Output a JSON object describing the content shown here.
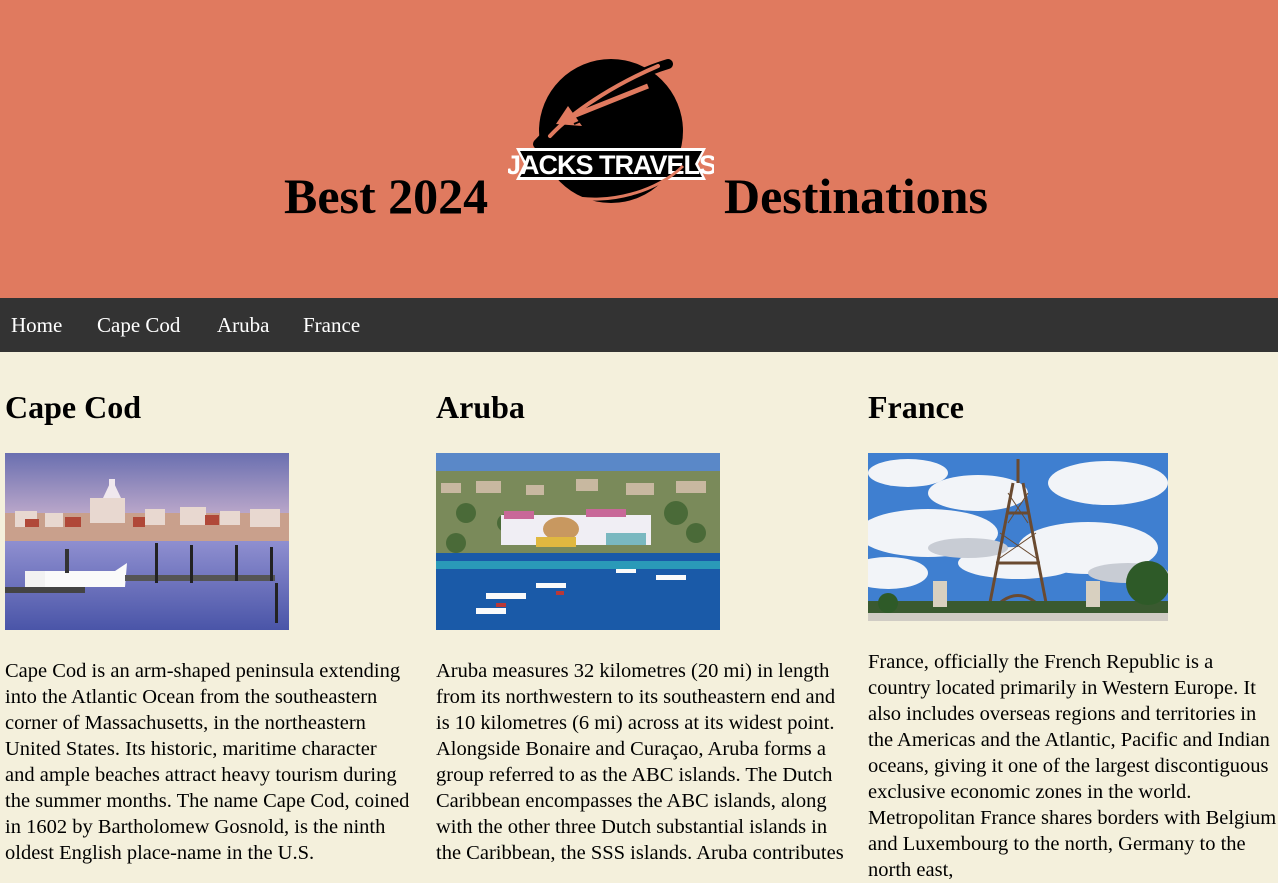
{
  "header": {
    "title_left": "Best 2024",
    "title_right": "Destinations",
    "logo_text": "JACKS TRAVELS",
    "background": "#e07a5f"
  },
  "nav": {
    "background": "#333333",
    "items": [
      {
        "label": "Home"
      },
      {
        "label": "Cape Cod"
      },
      {
        "label": "Aruba"
      },
      {
        "label": "France"
      }
    ]
  },
  "destinations": [
    {
      "heading": "Cape Cod",
      "image_icon": "harbor-photo",
      "text": "Cape Cod is an arm-shaped peninsula extending into the Atlantic Ocean from the southeastern corner of Massachusetts, in the northeastern United States. Its historic, maritime character and ample beaches attract heavy tourism during the summer months. The name Cape Cod, coined in 1602 by Bartholomew Gosnold, is the ninth oldest English place-name in the U.S."
    },
    {
      "heading": "Aruba",
      "image_icon": "aerial-town-photo",
      "text": "Aruba measures 32 kilometres (20 mi) in length from its northwestern to its southeastern end and is 10 kilometres (6 mi) across at its widest point. Alongside Bonaire and Curaçao, Aruba forms a group referred to as the ABC islands. The Dutch Caribbean encompasses the ABC islands, along with the other three Dutch substantial islands in the Caribbean, the SSS islands. Aruba contributes"
    },
    {
      "heading": "France",
      "image_icon": "eiffel-tower-photo",
      "text": "France, officially the French Republic is a country located primarily in Western Europe. It also includes overseas regions and territories in the Americas and the Atlantic, Pacific and Indian oceans, giving it one of the largest discontiguous exclusive economic zones in the world. Metropolitan France shares borders with Belgium and Luxembourg to the north, Germany to the north east,"
    }
  ],
  "colors": {
    "page_background": "#f4f0dc",
    "nav_text": "#ffffff"
  }
}
